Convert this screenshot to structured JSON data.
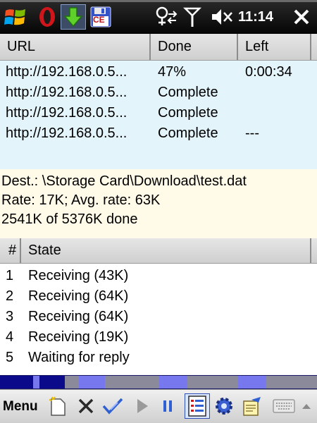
{
  "taskbar": {
    "time": "11:14",
    "icons": [
      "windows-flag-icon",
      "opera-icon",
      "download-arrow-icon",
      "floppy-ce-icon",
      "connectivity-icon",
      "signal-icon",
      "volume-muted-icon",
      "close-icon"
    ],
    "floppy_label": "CE"
  },
  "downloads": {
    "columns": [
      "URL",
      "Done",
      "Left"
    ],
    "rows": [
      {
        "url": "http://192.168.0.5...",
        "done": "47%",
        "left": "0:00:34"
      },
      {
        "url": "http://192.168.0.5...",
        "done": "Complete",
        "left": ""
      },
      {
        "url": "http://192.168.0.5...",
        "done": "Complete",
        "left": ""
      },
      {
        "url": "http://192.168.0.5...",
        "done": "Complete",
        "left": "---"
      }
    ]
  },
  "info": {
    "dest": "Dest.: \\Storage Card\\Download\\test.dat",
    "rate": "Rate: 17K; Avg. rate: 63K",
    "progress": "2541K of 5376K done"
  },
  "states": {
    "columns": [
      "#",
      "State"
    ],
    "rows": [
      {
        "n": "1",
        "state": "Receiving (43K)"
      },
      {
        "n": "2",
        "state": "Receiving (64K)"
      },
      {
        "n": "3",
        "state": "Receiving (64K)"
      },
      {
        "n": "4",
        "state": "Receiving (19K)"
      },
      {
        "n": "5",
        "state": "Waiting for reply"
      }
    ]
  },
  "segments": {
    "dark_color": "#0a0a8a",
    "light_color": "#7777ee",
    "grey_color": "#8a8a9a",
    "blocks": [
      {
        "start": 0.0,
        "end": 0.105,
        "kind": "dark"
      },
      {
        "start": 0.125,
        "end": 0.205,
        "kind": "dark"
      },
      {
        "start": 0.205,
        "end": 0.25,
        "kind": "grey"
      },
      {
        "start": 0.33,
        "end": 0.5,
        "kind": "grey"
      },
      {
        "start": 0.59,
        "end": 0.75,
        "kind": "grey"
      },
      {
        "start": 0.84,
        "end": 1.0,
        "kind": "grey"
      }
    ]
  },
  "menubar": {
    "menu_label": "Menu",
    "tools": [
      "new-download-icon",
      "delete-icon",
      "check-icon",
      "play-icon",
      "pause-icon",
      "list-view-icon",
      "settings-gear-icon",
      "notes-icon",
      "keyboard-icon",
      "sip-arrow-up-icon"
    ]
  }
}
